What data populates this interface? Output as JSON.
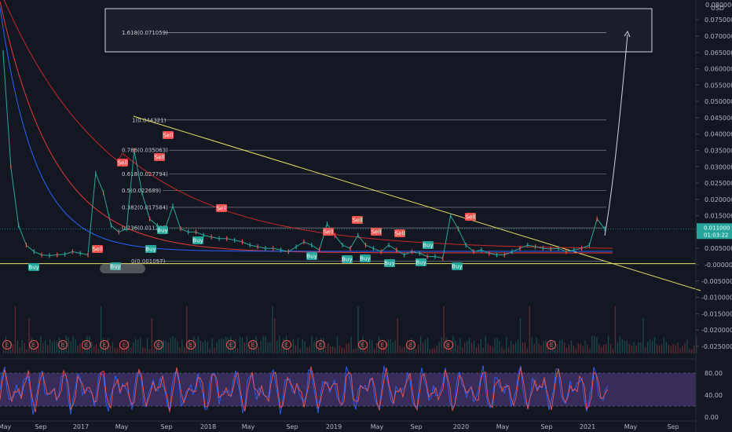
{
  "chart_data": [
    {
      "type": "line",
      "currency": "USD",
      "y_scale": "linear",
      "ylim": [
        -0.0275,
        0.0805
      ],
      "y_ticks": [
        0.075,
        0.07,
        0.065,
        0.06,
        0.055,
        0.05,
        0.045,
        0.04,
        0.035,
        0.03,
        0.025,
        0.02,
        0.015,
        0.01,
        0.005,
        0.0,
        -0.005,
        -0.01,
        -0.015,
        -0.02,
        -0.025
      ],
      "y_tick_labels": [
        "0.075000",
        "0.070000",
        "0.065000",
        "0.060000",
        "0.055000",
        "0.050000",
        "0.045000",
        "0.040000",
        "0.035000",
        "0.030000",
        "0.025000",
        "0.020000",
        "0.015000",
        "0.010000",
        "0.005000",
        "-0.000000",
        "-0.005000",
        "-0.010000",
        "-0.015000",
        "-0.020000",
        "-0.025000"
      ],
      "top_tick_label": "0.080000",
      "x_tick_labels": [
        "May",
        "Sep",
        "2017",
        "May",
        "Sep",
        "2018",
        "May",
        "Sep",
        "2019",
        "May",
        "Sep",
        "2020",
        "May",
        "Sep",
        "2021",
        "May",
        "Sep"
      ],
      "last_price": "0.011000",
      "countdown": "01:03:22",
      "fib_levels": [
        {
          "level": "1",
          "value": 0.044321
        },
        {
          "level": "0.786",
          "value": 0.035063
        },
        {
          "level": "0.618",
          "value": 0.027794
        },
        {
          "level": "0.5",
          "value": 0.022689
        },
        {
          "level": "0.382",
          "value": 0.017584
        },
        {
          "level": "0.236",
          "value": 0.011267
        },
        {
          "level": "0",
          "value": 0.001057
        }
      ],
      "fib_extension": {
        "level": "1.618",
        "value": 0.071059
      },
      "signals": [
        {
          "label": "Buy",
          "index": 0
        },
        {
          "label": "Sell",
          "index": 1
        },
        {
          "label": "Buy",
          "index": 2
        },
        {
          "label": "Sell",
          "index": 3
        },
        {
          "label": "Sell",
          "index": 4
        },
        {
          "label": "Sell",
          "index": 5
        },
        {
          "label": "Buy",
          "index": 6
        },
        {
          "label": "Buy",
          "index": 7
        },
        {
          "label": "Buy",
          "index": 8
        },
        {
          "label": "Sell",
          "index": 9
        },
        {
          "label": "Sell",
          "index": 10
        },
        {
          "label": "Buy",
          "index": 11
        },
        {
          "label": "Sell",
          "index": 12
        },
        {
          "label": "Buy",
          "index": 13
        },
        {
          "label": "Sell",
          "index": 14
        },
        {
          "label": "Buy",
          "index": 15
        },
        {
          "label": "Buy",
          "index": 16
        },
        {
          "label": "Sell",
          "index": 17
        },
        {
          "label": "Buy",
          "index": 18
        },
        {
          "label": "Buy",
          "index": 19
        },
        {
          "label": "Sell",
          "index": 20
        },
        {
          "label": "Buy",
          "index": 21
        }
      ],
      "earnings_marker": "E",
      "series": [
        {
          "values": [
            0.065,
            0.03,
            0.012,
            0.006,
            0.004,
            0.003,
            0.0028,
            0.003,
            0.0032,
            0.004,
            0.0035,
            0.003,
            0.028,
            0.022,
            0.012,
            0.01,
            0.011,
            0.035,
            0.022,
            0.014,
            0.012,
            0.011,
            0.018,
            0.011,
            0.01,
            0.01,
            0.009,
            0.0085,
            0.008,
            0.008,
            0.0075,
            0.007,
            0.006,
            0.0055,
            0.005,
            0.005,
            0.0045,
            0.004,
            0.0055,
            0.007,
            0.006,
            0.0045,
            0.0125,
            0.009,
            0.006,
            0.005,
            0.009,
            0.006,
            0.005,
            0.004,
            0.006,
            0.0045,
            0.003,
            0.004,
            0.0035,
            0.0025,
            0.0025,
            0.002,
            0.015,
            0.011,
            0.006,
            0.004,
            0.0045,
            0.0035,
            0.003,
            0.003,
            0.004,
            0.005,
            0.006,
            0.0055,
            0.005,
            0.0048,
            0.005,
            0.004,
            0.0045,
            0.005,
            0.006,
            0.014,
            0.011
          ]
        }
      ]
    },
    {
      "type": "line",
      "ylim": [
        0,
        100
      ],
      "y_ticks": [
        80,
        40,
        0
      ],
      "y_tick_labels": [
        "80.00",
        "40.00",
        "0.00"
      ],
      "band": [
        20,
        80
      ]
    }
  ]
}
